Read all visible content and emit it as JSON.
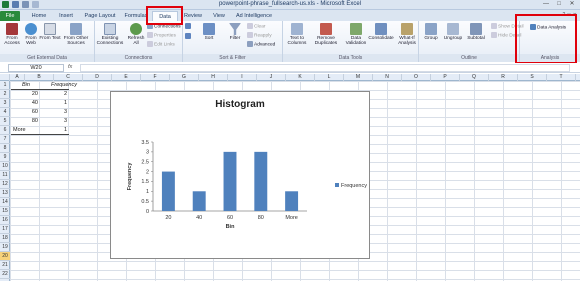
{
  "window": {
    "title": "powerpoint-phrase_fullsearch-us.xls - Microsoft Excel",
    "controls": [
      "—",
      "□",
      "✕"
    ]
  },
  "tabs": [
    "File",
    "Home",
    "Insert",
    "Page Layout",
    "Formulas",
    "Data",
    "Review",
    "View",
    "Ad Intelligence"
  ],
  "active_tab": "Data",
  "ribbon": {
    "groups": {
      "external": "Get External Data",
      "connections": "Connections",
      "sortfilter": "Sort & Filter",
      "datatools": "Data Tools",
      "outline": "Outline",
      "analysis": "Analysis"
    },
    "buttons": {
      "from_access": "From Access",
      "from_web": "From Web",
      "from_text": "From Text",
      "from_other": "From Other Sources",
      "existing": "Existing Connections",
      "refresh": "Refresh All",
      "connections": "Connections",
      "properties": "Properties",
      "edit_links": "Edit Links",
      "sort": "Sort",
      "filter": "Filter",
      "clear": "Clear",
      "reapply": "Reapply",
      "advanced": "Advanced",
      "text_to_columns": "Text to Columns",
      "remove_dup": "Remove Duplicates",
      "validation": "Data Validation",
      "consolidate": "Consolidate",
      "whatif": "What-If Analysis",
      "group": "Group",
      "ungroup": "Ungroup",
      "subtotal": "Subtotal",
      "show_detail": "Show Detail",
      "hide_detail": "Hide Detail",
      "data_analysis": "Data Analysis"
    }
  },
  "formula_bar": {
    "name_box": "W20",
    "fx": "fx",
    "value": ""
  },
  "columns": [
    "A",
    "B",
    "C",
    "D",
    "E",
    "F",
    "G",
    "H",
    "I",
    "J",
    "K",
    "L",
    "M",
    "N",
    "O",
    "P",
    "Q",
    "R",
    "S",
    "T"
  ],
  "rows": [
    "1",
    "2",
    "3",
    "4",
    "5",
    "6",
    "7",
    "8",
    "9",
    "10",
    "11",
    "12",
    "13",
    "14",
    "15",
    "16",
    "17",
    "18",
    "19",
    "20",
    "21",
    "22"
  ],
  "selected_row": "20",
  "table": {
    "headers": [
      "Bin",
      "Frequency"
    ],
    "rows": [
      [
        "20",
        "2"
      ],
      [
        "40",
        "1"
      ],
      [
        "60",
        "3"
      ],
      [
        "80",
        "3"
      ],
      [
        "More",
        "1"
      ]
    ]
  },
  "colors": {
    "bar": "#4f81bd",
    "highlight": "#e0000b",
    "file_tab": "#2a8a3b"
  },
  "chart_data": {
    "type": "bar",
    "title": "Histogram",
    "categories": [
      "20",
      "40",
      "60",
      "80",
      "More"
    ],
    "series": [
      {
        "name": "Frequency",
        "values": [
          2,
          1,
          3,
          3,
          1
        ]
      }
    ],
    "xlabel": "Bin",
    "ylabel": "Frequency",
    "ylim": [
      0,
      3.5
    ],
    "yticks": [
      "0",
      "0.5",
      "1",
      "1.5",
      "2",
      "2.5",
      "3",
      "3.5"
    ],
    "legend": "right",
    "grid": false
  }
}
